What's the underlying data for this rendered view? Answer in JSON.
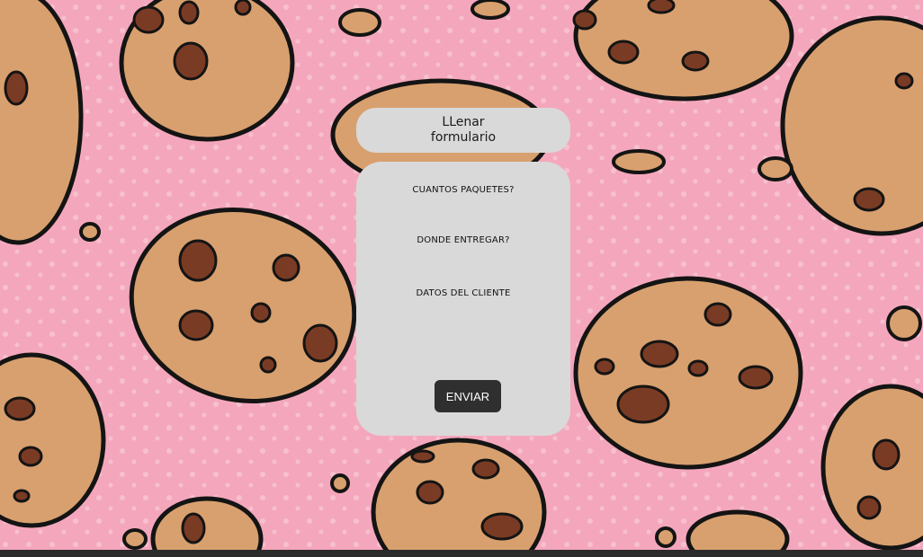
{
  "header": {
    "title": "LLenar\nformulario"
  },
  "form": {
    "fields": [
      {
        "label": "CUANTOS PAQUETES?"
      },
      {
        "label": "DONDE ENTREGAR?"
      },
      {
        "label": "DATOS DEL CLIENTE"
      }
    ],
    "submit_label": "ENVIAR"
  },
  "colors": {
    "background": "#f4a7bc",
    "card": "#d9d9d9",
    "button": "#2f2f2f",
    "cookie": "#d8a06e",
    "chip": "#7a3b24"
  },
  "icons": {
    "background_pattern": "cookie-pattern"
  }
}
